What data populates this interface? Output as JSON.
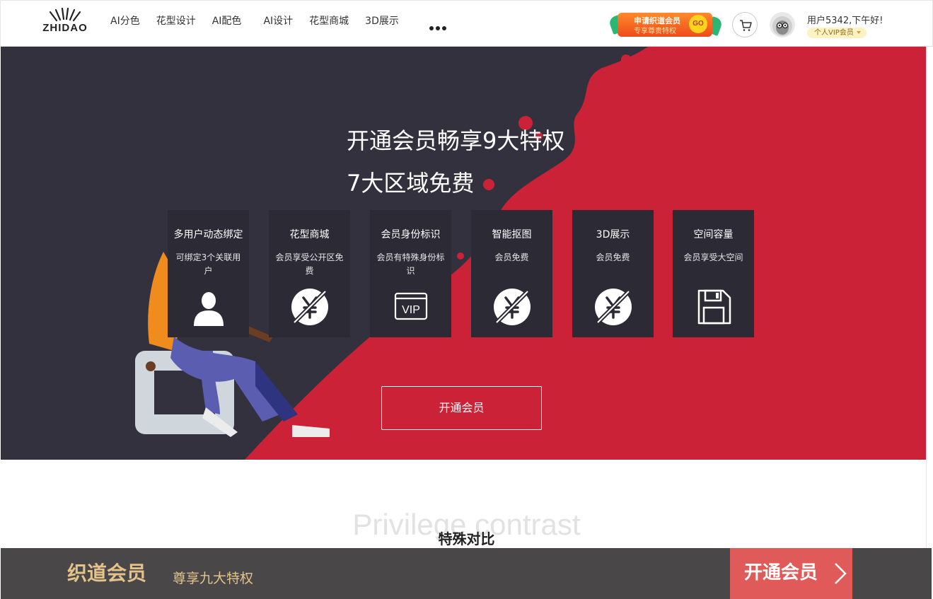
{
  "header": {
    "logo_text": "ZHIDAO",
    "nav": [
      "AI分色",
      "花型设计",
      "AI配色",
      "AI设计",
      "花型商城",
      "3D展示"
    ],
    "promo_line1": "申请织道会员",
    "promo_line2": "专享尊贵特权",
    "promo_go": "GO",
    "user_greeting": "用户5342,下午好!",
    "vip_label": "个人VIP会员"
  },
  "hero": {
    "title": "开通会员畅享9大特权",
    "subtitle": "7大区域免费",
    "cards": [
      {
        "title": "多用户动态绑定",
        "desc": "可绑定3个关联用户",
        "icon": "user-icon"
      },
      {
        "title": "花型商城",
        "desc": "会员享受公开区免费",
        "icon": "free-yuan-icon"
      },
      {
        "title": "会员身份标识",
        "desc": "会员有特殊身份标识",
        "icon": "vip-icon"
      },
      {
        "title": "智能抠图",
        "desc": "会员免费",
        "icon": "free-yuan-icon"
      },
      {
        "title": "3D展示",
        "desc": "会员免费",
        "icon": "free-yuan-icon"
      },
      {
        "title": "空间容量",
        "desc": "会员享受大空间",
        "icon": "storage-icon"
      }
    ],
    "cta_label": "开通会员",
    "vip_icon_text": "VIP"
  },
  "section": {
    "title_en": "Privilege contrast",
    "title_cn": "特殊对比"
  },
  "bottom_bar": {
    "brand": "织道会员",
    "tagline": "尊享九大特权",
    "button_label": "开通会员"
  },
  "colors": {
    "hero_dark": "#33313d",
    "hero_red": "#cc2238",
    "card_bg": "#2c2a35",
    "gold": "#e3c38a",
    "bottom_bar": "#4a4748",
    "bottom_button": "#e05a5a"
  }
}
